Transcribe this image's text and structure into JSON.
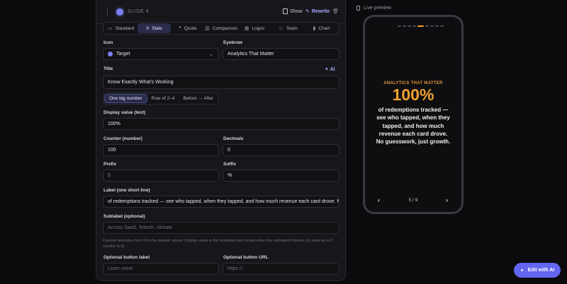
{
  "slide": {
    "label": "SLIDE 4"
  },
  "toolbar": {
    "show": "Show",
    "rewrite": "Rewrite"
  },
  "tabs": [
    {
      "icon": "▭",
      "label": "Standard"
    },
    {
      "icon": "#",
      "label": "Stats"
    },
    {
      "icon": "❝",
      "label": "Quote"
    },
    {
      "icon": "▥",
      "label": "Comparison"
    },
    {
      "icon": "▦",
      "label": "Logos"
    },
    {
      "icon": "☺",
      "label": "Team"
    },
    {
      "icon": "▮",
      "label": "Chart"
    }
  ],
  "form": {
    "icon_label": "Icon",
    "icon_value": "Target",
    "eyebrow_label": "Eyebrow",
    "eyebrow_value": "Analytics That Matter",
    "title_label": "Title",
    "ai_button": "AI",
    "title_value": "Know Exactly What's Working",
    "layout_options": [
      "One big number",
      "Row of 2–4",
      "Before → After"
    ],
    "display_label": "Display value (text)",
    "display_value": "100%",
    "counter_label": "Counter (number)",
    "counter_value": "100",
    "decimals_label": "Decimals",
    "decimals_value": "0",
    "prefix_label": "Prefix",
    "prefix_placeholder": "$",
    "suffix_label": "Suffix",
    "suffix_value": "%",
    "statlabel_label": "Label (one short line)",
    "statlabel_value": "of redemptions tracked — see who tapped, when they tapped, and how much revenue each card drove. N",
    "sublabel_label": "Sublabel (optional)",
    "sublabel_placeholder": "Across SaaS, fintech, climate",
    "help_text": "Counter animates from 0 to the number above. Display value is the formatted text shown when the animation finishes (or used as-is if counter is 0).",
    "btnlabel_label": "Optional button label",
    "btnlabel_placeholder": "Learn more",
    "btnurl_label": "Optional button URL",
    "btnurl_placeholder": "https://..."
  },
  "preview": {
    "label": "Live preview",
    "eyebrow": "ANALYTICS THAT MATTER",
    "value": "100%",
    "stat_label": "of redemptions tracked — see who tapped, when they tapped, and how much revenue each card drove. No guesswork, just growth.",
    "counter": "5 / 9",
    "prev": "‹",
    "next": "›"
  },
  "fab": {
    "label": "Edit with AI"
  },
  "colors": {
    "accent": "#6366f1",
    "stat": "#f0a030",
    "background": "#0b0b0d",
    "panel": "#17171b"
  }
}
